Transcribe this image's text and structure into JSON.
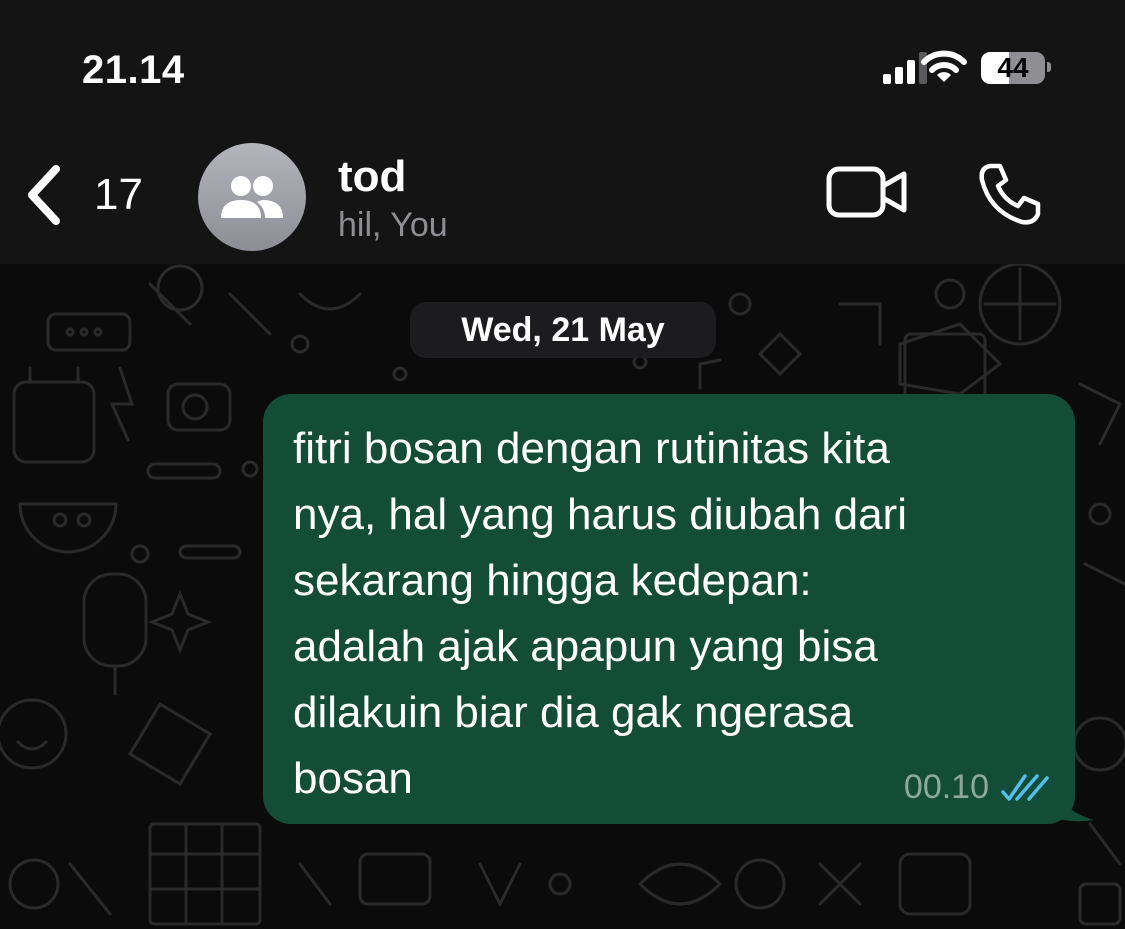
{
  "status_bar": {
    "time": "21.14",
    "battery": "44"
  },
  "header": {
    "back_count": "17",
    "title": "tod",
    "subtitle": "hil, You"
  },
  "chat": {
    "date_separator": "Wed, 21 May",
    "messages": [
      {
        "direction": "outgoing",
        "lines": [
          "fitri bosan dengan rutinitas kita",
          "nya, hal yang harus diubah dari",
          "sekarang hingga kedepan:",
          "adalah ajak apapun yang bisa",
          "dilakuin biar dia gak ngerasa",
          "bosan"
        ],
        "time": "00.10",
        "status": "read"
      }
    ]
  },
  "colors": {
    "header_bg": "#141414",
    "chat_bg": "#0b0b0b",
    "outgoing_bubble": "#144d37",
    "read_ticks": "#53bdeb",
    "secondary_text": "#8e8e93"
  },
  "icons": [
    "signal-icon",
    "wifi-icon",
    "battery-icon",
    "back-chevron-icon",
    "group-icon",
    "video-call-icon",
    "phone-icon",
    "double-check-icon"
  ]
}
